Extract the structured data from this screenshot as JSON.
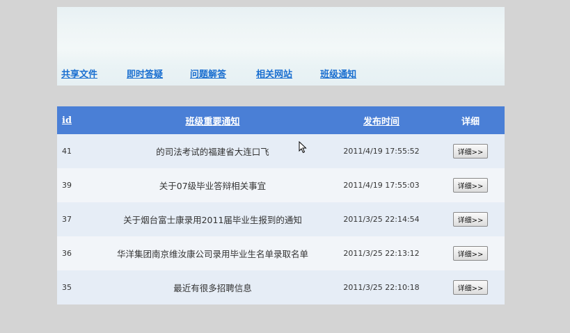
{
  "nav": {
    "links": [
      "共享文件",
      "即时答疑",
      "问题解答",
      "相关网站",
      "班级通知"
    ]
  },
  "table": {
    "headers": {
      "id": "id",
      "title": "班级重要通知",
      "time": "发布时间",
      "detail": "详细"
    },
    "rows": [
      {
        "id": "41",
        "title": "的司法考试的福建省大连口飞",
        "time": "2011/4/19 17:55:52",
        "button": "详细>>"
      },
      {
        "id": "39",
        "title": "关于07级毕业答辩相关事宜",
        "time": "2011/4/19 17:55:03",
        "button": "详细>>"
      },
      {
        "id": "37",
        "title": "关于烟台富士康录用2011届毕业生报到的通知",
        "time": "2011/3/25 22:14:54",
        "button": "详细>>"
      },
      {
        "id": "36",
        "title": "华洋集团南京维汝康公司录用毕业生名单录取名单",
        "time": "2011/3/25 22:13:12",
        "button": "详细>>"
      },
      {
        "id": "35",
        "title": "最近有很多招聘信息",
        "time": "2011/3/25 22:10:18",
        "button": "详细>>"
      }
    ]
  },
  "colors": {
    "header_row": "#4a7fd6",
    "link": "#1a6fd0",
    "background": "#d4d4d4"
  }
}
